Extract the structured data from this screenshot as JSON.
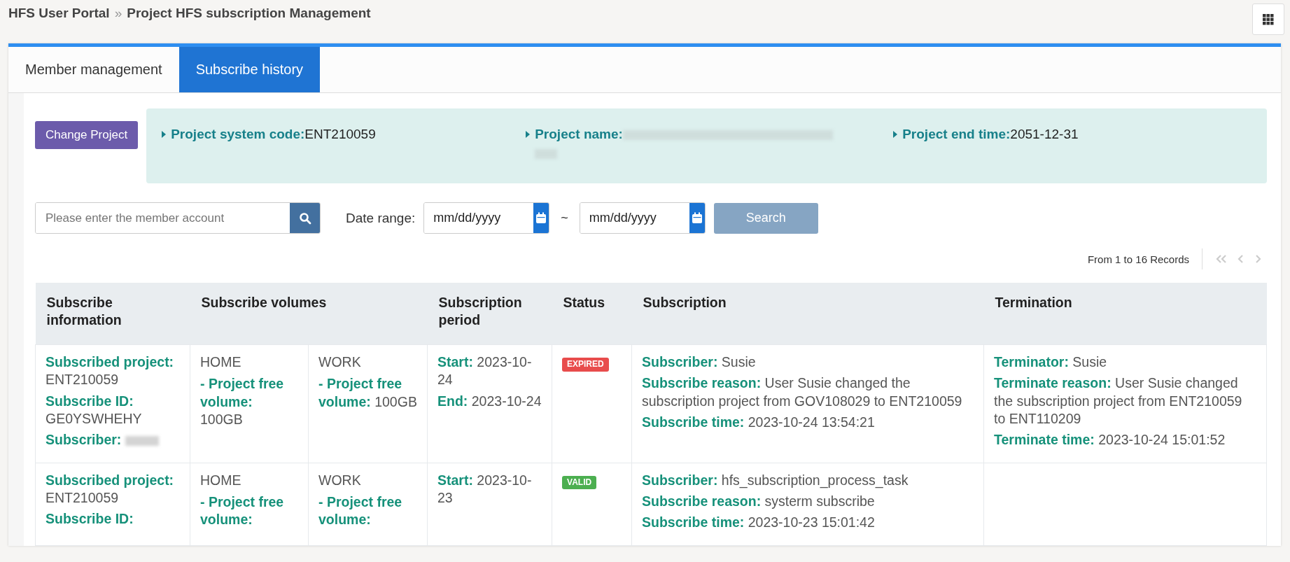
{
  "breadcrumb": {
    "items": [
      "HFS User Portal",
      "Project HFS subscription Management"
    ],
    "separator": "»"
  },
  "tabs": [
    {
      "label": "Member management",
      "selected": false
    },
    {
      "label": "Subscribe history",
      "selected": true
    }
  ],
  "change_project_button": "Change Project",
  "project_info": [
    {
      "label": "Project system code:",
      "value": "ENT210059",
      "redacted": false
    },
    {
      "label": "Project name:",
      "redacted": true
    },
    {
      "label": "Project end time:",
      "value": "2051-12-31",
      "redacted": false
    }
  ],
  "filters": {
    "account_placeholder": "Please enter the member account",
    "date_label": "Date range:",
    "date_from_placeholder": "mm/dd/yyyy",
    "range_separator": "~",
    "date_to_placeholder": "mm/dd/yyyy",
    "search_button": "Search"
  },
  "records": "From 1 to 16 Records",
  "table": {
    "columns": [
      "Subscribe information",
      "Subscribe volumes",
      "Subscription period",
      "Status",
      "Subscription",
      "Termination"
    ],
    "rows": [
      {
        "info": [
          {
            "label": "Subscribed project:",
            "value": "ENT210059"
          },
          {
            "label": "Subscribe ID:",
            "value": "GE0YSWHEHY"
          },
          {
            "label": "Subscriber:",
            "redacted": true
          }
        ],
        "volumes": [
          {
            "name": "HOME",
            "label": "- Project free volume:",
            "value": "100GB"
          },
          {
            "name": "WORK",
            "label": "- Project free volume:",
            "value": "100GB"
          }
        ],
        "period": [
          {
            "label": "Start:",
            "value": "2023-10-24"
          },
          {
            "label": "End:",
            "value": "2023-10-24"
          }
        ],
        "status": {
          "label": "EXPIRED",
          "kind": "expired"
        },
        "subscription": [
          {
            "label": "Subscriber:",
            "value": "Susie"
          },
          {
            "label": "Subscribe reason:",
            "value": "User Susie changed the subscription project from GOV108029 to ENT210059"
          },
          {
            "label": "Subscribe time:",
            "value": "2023-10-24 13:54:21"
          }
        ],
        "termination": [
          {
            "label": "Terminator:",
            "value": "Susie"
          },
          {
            "label": "Terminate reason:",
            "value": "User Susie changed the subscription project from ENT210059 to ENT110209"
          },
          {
            "label": "Terminate time:",
            "value": "2023-10-24 15:01:52"
          }
        ]
      },
      {
        "info": [
          {
            "label": "Subscribed project:",
            "value": "ENT210059"
          },
          {
            "label": "Subscribe ID:"
          }
        ],
        "volumes": [
          {
            "name": "HOME",
            "label": "- Project free volume:"
          },
          {
            "name": "WORK",
            "label": "- Project free volume:"
          }
        ],
        "period": [
          {
            "label": "Start:",
            "value": "2023-10-23"
          }
        ],
        "status": {
          "label": "VALID",
          "kind": "valid"
        },
        "subscription": [
          {
            "label": "Subscriber:",
            "value": "hfs_subscription_process_task"
          },
          {
            "label": "Subscribe reason:",
            "value": "systerm subscribe"
          },
          {
            "label": "Subscribe time:",
            "value": "2023-10-23 15:01:42"
          }
        ],
        "termination": []
      }
    ]
  }
}
